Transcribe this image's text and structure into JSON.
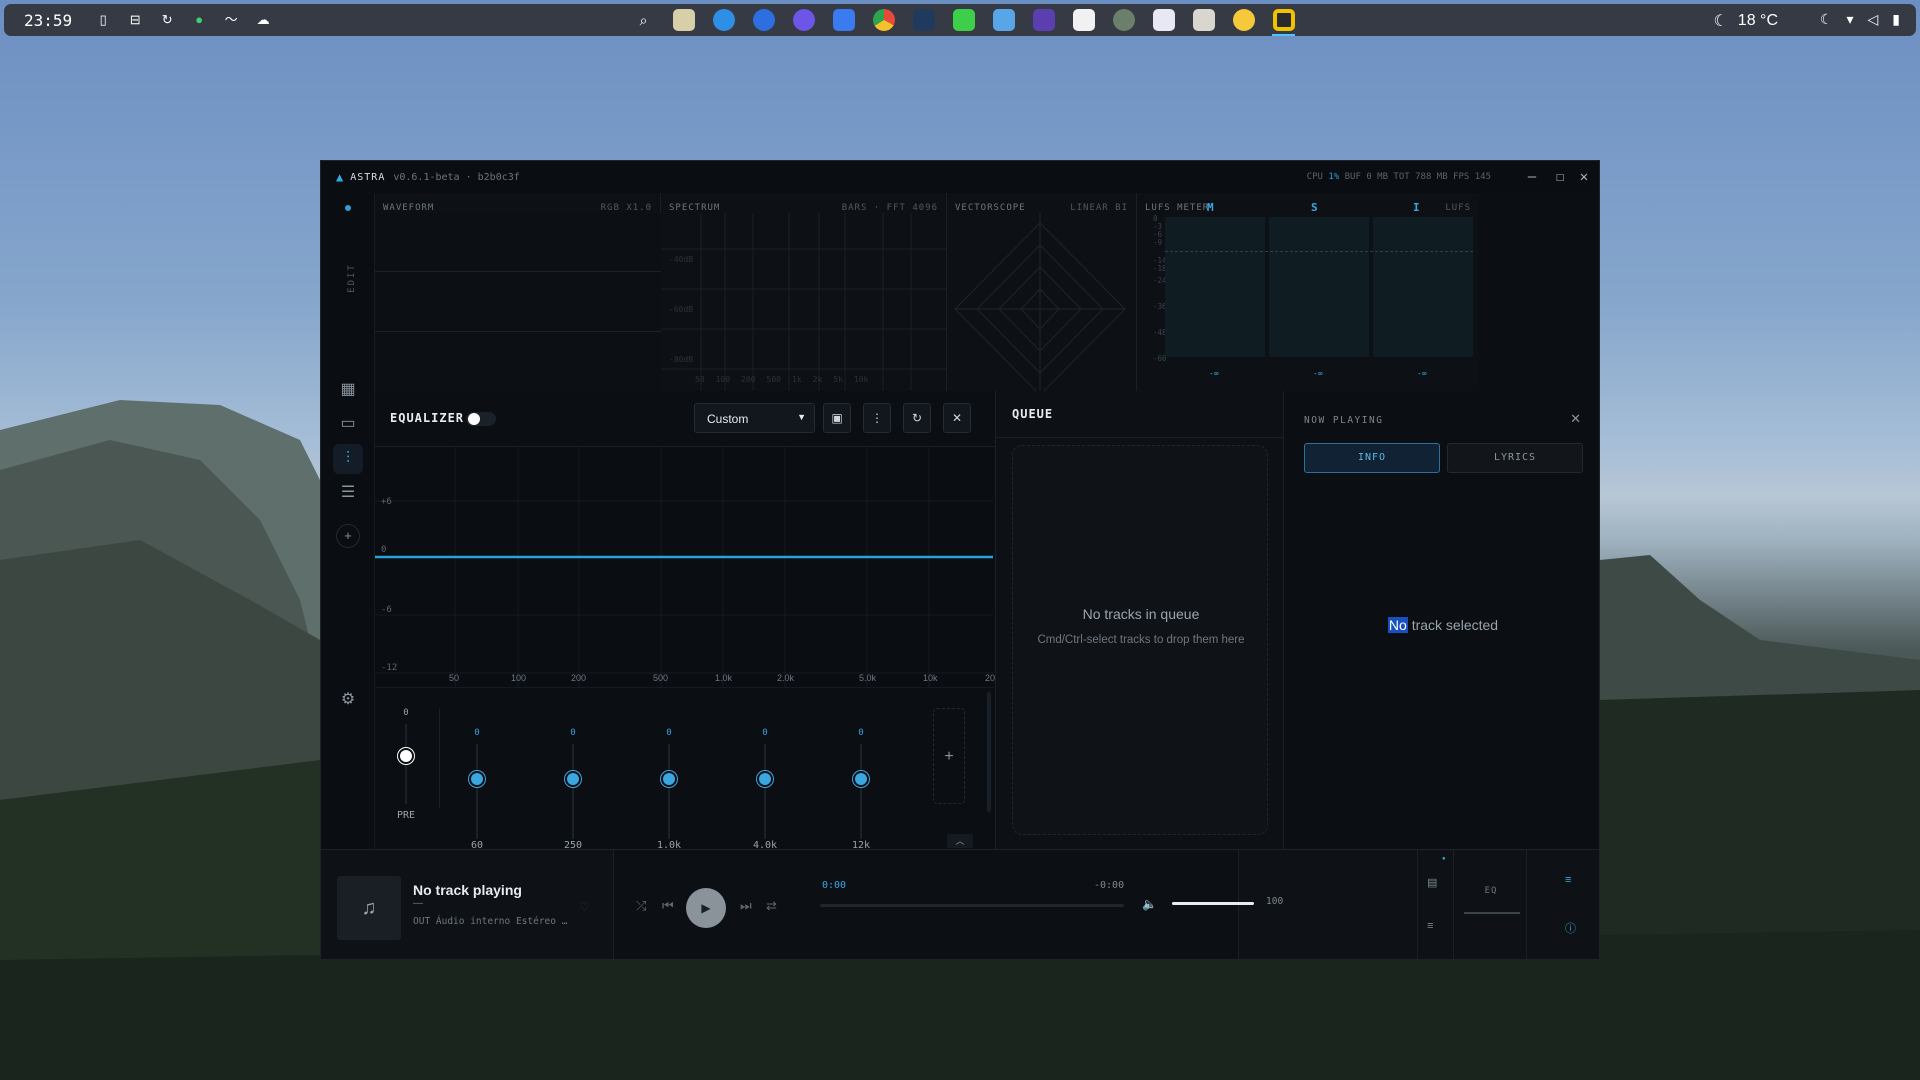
{
  "topbar": {
    "time": "23:59",
    "weather": "18 °C",
    "dock_apps": [
      "search",
      "files",
      "safari",
      "browser",
      "messenger",
      "tasks",
      "chrome",
      "editor",
      "android-studio",
      "screen",
      "shortcuts",
      "cards",
      "tor",
      "store",
      "zed",
      "lemon",
      "app-active"
    ]
  },
  "window": {
    "app_name": "ASTRA",
    "version": "v0.6.1-beta · b2b0c3f",
    "stats": {
      "cpu_label": "CPU",
      "cpu": "1%",
      "buf_label": "BUF",
      "buf": "0 MB",
      "tot_label": "TOT",
      "tot": "788 MB",
      "fps_label": "FPS",
      "fps": "145"
    }
  },
  "rail": {
    "edit_label": "EDIT"
  },
  "visualizers": {
    "waveform": {
      "label": "WAVEFORM",
      "mode": "RGB X1.0"
    },
    "spectrum": {
      "label": "SPECTRUM",
      "mode": "BARS · FFT 4096",
      "db_ticks": [
        "-40dB",
        "-60dB",
        "-80dB"
      ],
      "freq_ticks": [
        "50",
        "100",
        "200",
        "500",
        "1k",
        "2k",
        "5k",
        "10k"
      ]
    },
    "vectorscope": {
      "label": "VECTORSCOPE",
      "mode": "LINEAR BI"
    },
    "lufs": {
      "label": "LUFS METER",
      "m": "M",
      "s": "S",
      "i": "I",
      "unit": "LUFS",
      "scale": [
        "0",
        "-3",
        "-6",
        "-9",
        "-14",
        "-18",
        "-24",
        "-36",
        "-48",
        "-60"
      ],
      "readouts": [
        "-∞",
        "-∞",
        "-∞"
      ]
    }
  },
  "equalizer": {
    "title": "EQUALIZER",
    "enabled": false,
    "preset": "Custom",
    "gain_ticks": [
      "+6",
      "0",
      "-6",
      "-12"
    ],
    "freq_ticks": [
      "50",
      "100",
      "200",
      "500",
      "1.0k",
      "2.0k",
      "5.0k",
      "10k",
      "20"
    ],
    "preamp": {
      "value": "0",
      "label": "PRE"
    },
    "bands": [
      {
        "value": "0",
        "label": "60"
      },
      {
        "value": "0",
        "label": "250"
      },
      {
        "value": "0",
        "label": "1.0k"
      },
      {
        "value": "0",
        "label": "4.0k"
      },
      {
        "value": "0",
        "label": "12k"
      }
    ],
    "add_label": "+"
  },
  "queue": {
    "title": "QUEUE",
    "empty": "No tracks in queue",
    "hint": "Cmd/Ctrl-select tracks to drop them here"
  },
  "now_playing": {
    "title": "NOW PLAYING",
    "tab_info": "INFO",
    "tab_lyrics": "LYRICS",
    "empty_highlight": "No",
    "empty_rest": " track selected"
  },
  "player": {
    "track": "No track playing",
    "dash": "—",
    "device": "OUT Áudio interno Estéreo …",
    "time_current": "0:00",
    "time_remaining": "-0:00",
    "volume": "100",
    "eq_label": "EQ"
  }
}
